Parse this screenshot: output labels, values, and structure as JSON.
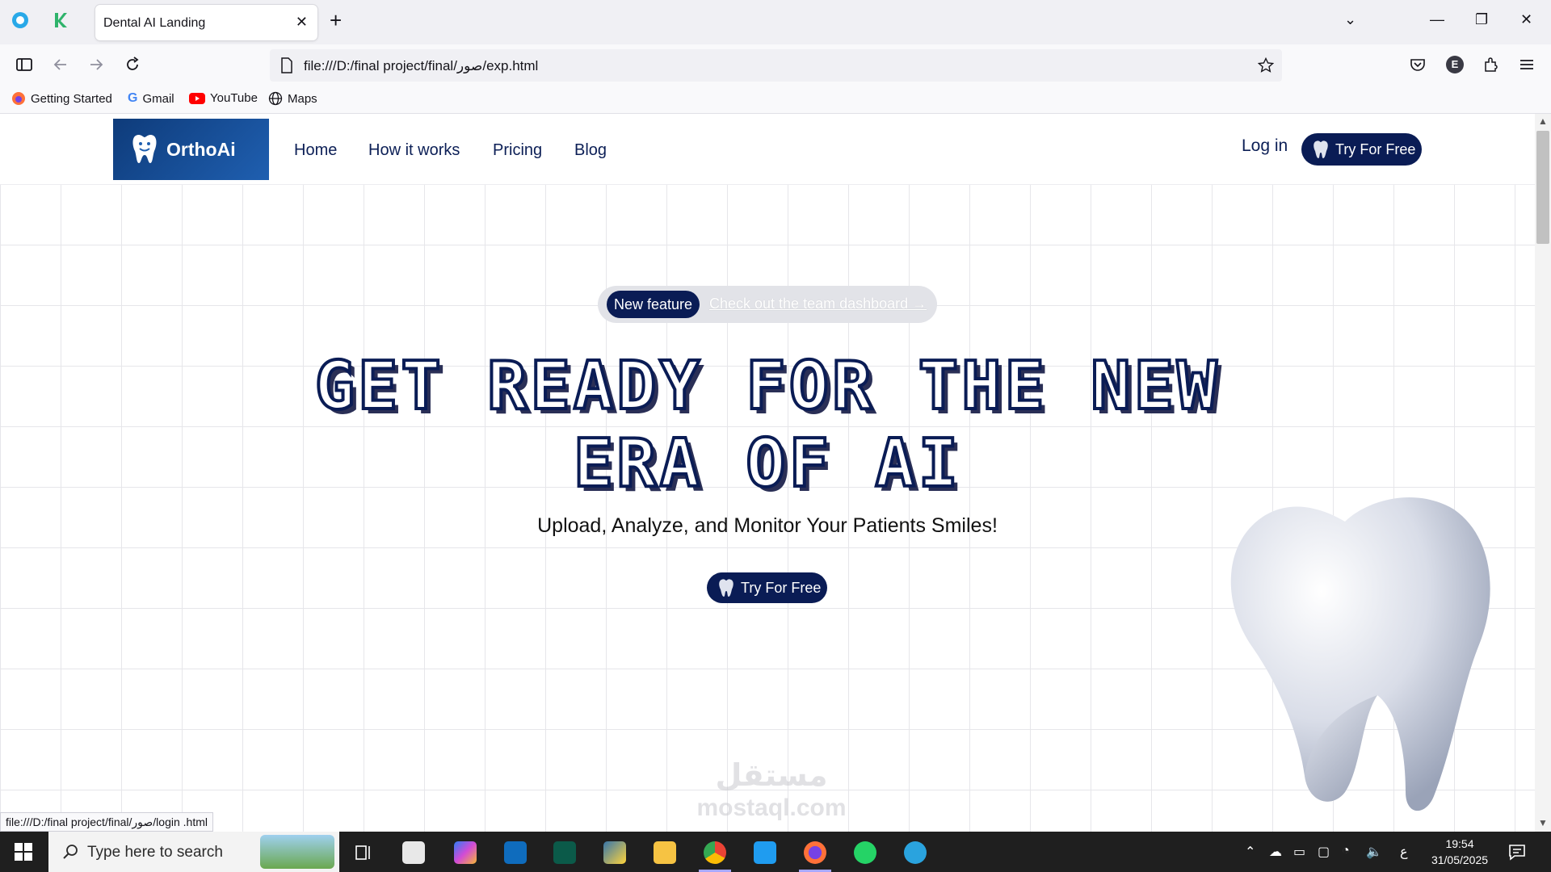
{
  "browser": {
    "tab_title": "Dental AI Landing",
    "url": "file:///D:/final project/final/صور/exp.html",
    "bookmarks": [
      "Getting Started",
      "Gmail",
      "YouTube",
      "Maps"
    ],
    "status_url": "file:///D:/final project/final/صور/login .html",
    "profile_initial": "E"
  },
  "site": {
    "logo_text": "OrthoAi",
    "nav": [
      "Home",
      "How it works",
      "Pricing",
      "Blog"
    ],
    "login_label": "Log in",
    "cta_label": "Try For Free",
    "pill_badge": "New feature",
    "pill_link": "Check out the team dashboard →",
    "headline_line1": "GET READY FOR THE NEW",
    "headline_line2": "ERA OF AI",
    "subline": "Upload, Analyze, and Monitor Your Patients Smiles!",
    "watermark": "مستقل",
    "watermark_sub": "mostaql.com"
  },
  "taskbar": {
    "search_placeholder": "Type here to search",
    "time": "19:54",
    "date": "31/05/2025",
    "lang": "ع"
  },
  "colors": {
    "navy": "#0a1c55",
    "logo_bg": "#1f5fb0"
  }
}
